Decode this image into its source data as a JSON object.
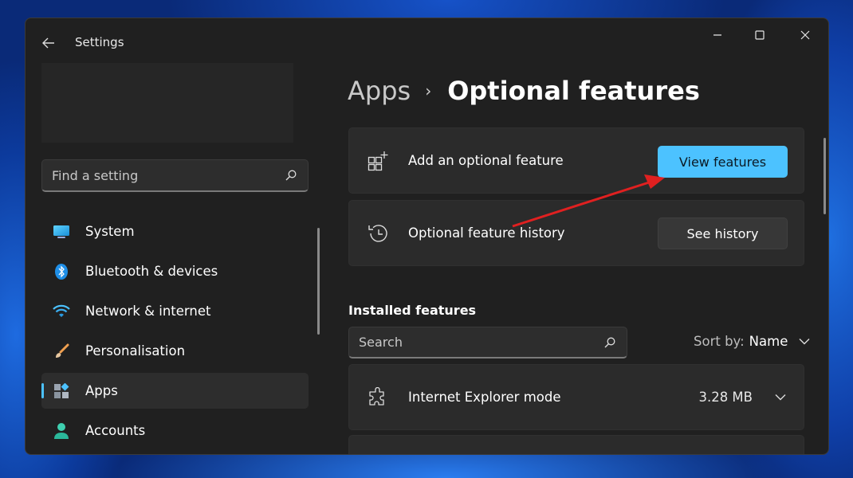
{
  "window": {
    "title": "Settings"
  },
  "sidebar": {
    "search_placeholder": "Find a setting",
    "items": [
      {
        "label": "System",
        "icon": "monitor-icon"
      },
      {
        "label": "Bluetooth & devices",
        "icon": "bluetooth-icon"
      },
      {
        "label": "Network & internet",
        "icon": "wifi-icon"
      },
      {
        "label": "Personalisation",
        "icon": "brush-icon"
      },
      {
        "label": "Apps",
        "icon": "apps-icon",
        "active": true
      },
      {
        "label": "Accounts",
        "icon": "person-icon"
      }
    ]
  },
  "breadcrumb": {
    "parent": "Apps",
    "separator": "›",
    "current": "Optional features"
  },
  "cards": {
    "add": {
      "label": "Add an optional feature",
      "button": "View features"
    },
    "history": {
      "label": "Optional feature history",
      "button": "See history"
    }
  },
  "installed": {
    "title": "Installed features",
    "search_placeholder": "Search",
    "sort_label": "Sort by:",
    "sort_value": "Name",
    "features": [
      {
        "name": "Internet Explorer mode",
        "size": "3.28 MB"
      }
    ]
  },
  "colors": {
    "accent": "#4cc2ff",
    "window_bg": "#202020",
    "card_bg": "#2b2b2b",
    "annotation_arrow": "#e02020"
  }
}
